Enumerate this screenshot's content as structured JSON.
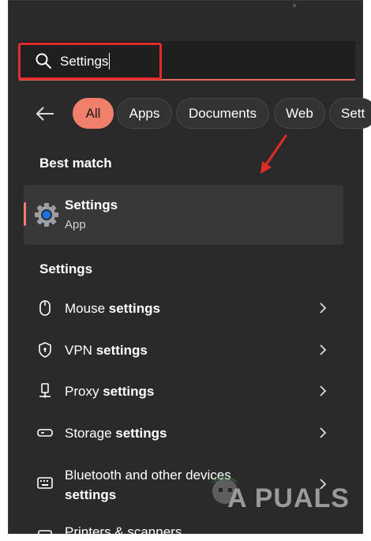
{
  "search": {
    "value": "Settings"
  },
  "filters": [
    "All",
    "Apps",
    "Documents",
    "Web",
    "Sett"
  ],
  "best_match": {
    "title": "Best match",
    "name": "Settings",
    "type": "App"
  },
  "settings_section": {
    "title": "Settings",
    "items": [
      {
        "prefix": "Mouse ",
        "bold": "settings",
        "icon": "mouse-icon"
      },
      {
        "prefix": "VPN ",
        "bold": "settings",
        "icon": "shield-icon"
      },
      {
        "prefix": "Proxy ",
        "bold": "settings",
        "icon": "network-icon"
      },
      {
        "prefix": "Storage ",
        "bold": "settings",
        "icon": "storage-icon"
      },
      {
        "line1": "Bluetooth and other devices",
        "line2": "settings",
        "icon": "keyboard-icon"
      },
      {
        "prefix": "Printers & scanners",
        "bold": "",
        "icon": "printer-icon"
      }
    ]
  },
  "watermark": {
    "text": "A PUALS"
  },
  "colors": {
    "accent": "#f0806b",
    "highlight": "#e02b2b",
    "panel": "#2a2a2a"
  }
}
